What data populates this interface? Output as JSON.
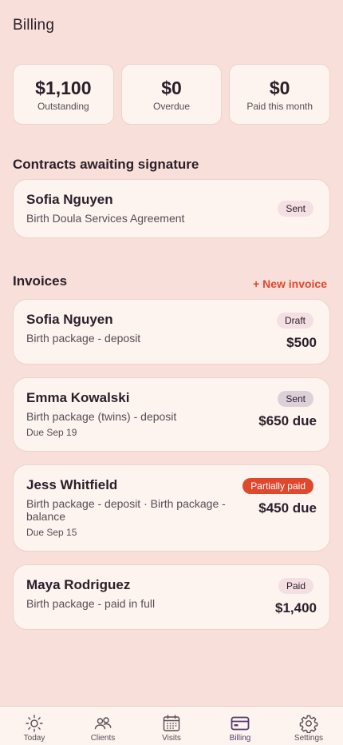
{
  "header": {
    "title": "Billing"
  },
  "stats": [
    {
      "value": "$1,100",
      "label": "Outstanding"
    },
    {
      "value": "$0",
      "label": "Overdue"
    },
    {
      "value": "$0",
      "label": "Paid this month"
    }
  ],
  "contracts": {
    "title": "Contracts awaiting signature",
    "items": [
      {
        "name": "Sofia Nguyen",
        "desc": "Birth Doula Services Agreement",
        "status": "Sent"
      }
    ]
  },
  "invoices": {
    "title": "Invoices",
    "new_label": "+ New invoice",
    "items": [
      {
        "name": "Sofia Nguyen",
        "desc": "Birth package - deposit",
        "status": "Draft",
        "amount": "$500",
        "due": ""
      },
      {
        "name": "Emma Kowalski",
        "desc": "Birth package (twins) - deposit",
        "status": "Sent",
        "amount": "$650 due",
        "due": "Due Sep 19"
      },
      {
        "name": "Jess Whitfield",
        "desc_line1": "Birth package - deposit · Birth package -",
        "desc_line2": "balance",
        "status": "Partially paid",
        "amount": "$450 due",
        "due": "Due Sep 15"
      },
      {
        "name": "Maya Rodriguez",
        "desc": "Birth package - paid in full",
        "status": "Paid",
        "amount": "$1,400",
        "due": ""
      }
    ]
  },
  "tabs": [
    {
      "label": "Today",
      "icon": "sun-icon"
    },
    {
      "label": "Clients",
      "icon": "people-icon"
    },
    {
      "label": "Visits",
      "icon": "calendar-icon"
    },
    {
      "label": "Billing",
      "icon": "card-icon",
      "active": true
    },
    {
      "label": "Settings",
      "icon": "gear-icon"
    }
  ],
  "colors": {
    "background": "#f8dfd9",
    "card": "#fdf4ef",
    "accent": "#e0482e",
    "active_tab": "#5a3a6e"
  }
}
